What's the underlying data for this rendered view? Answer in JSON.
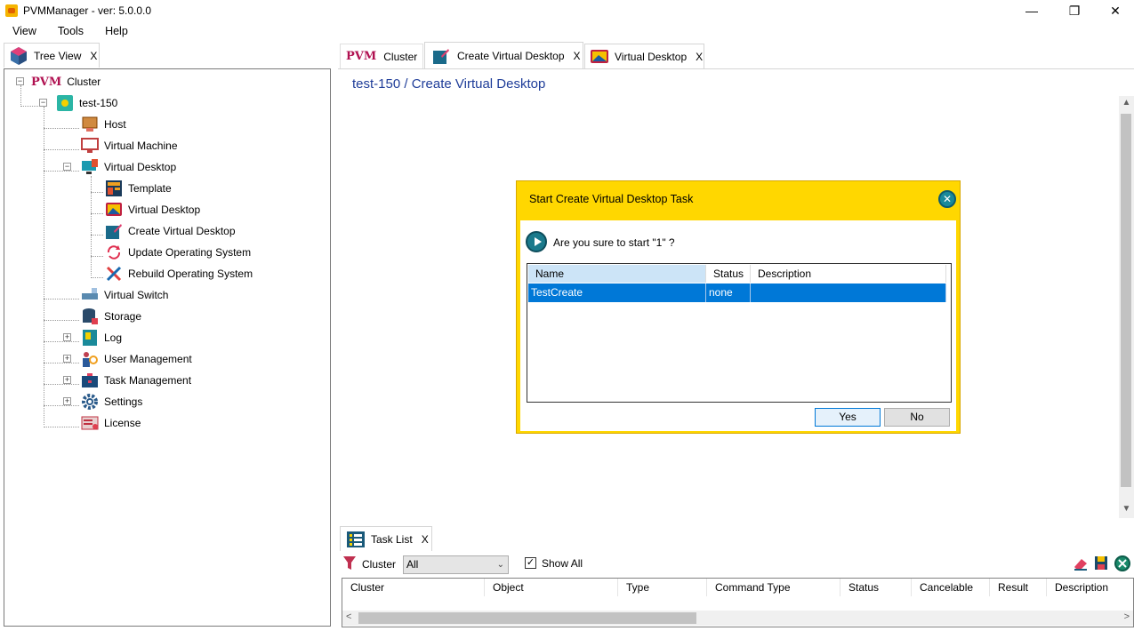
{
  "window": {
    "title": "PVMManager - ver: 5.0.0.0",
    "minimize": "—",
    "maximize": "❐",
    "close": "✕"
  },
  "menu": [
    "View",
    "Tools",
    "Help"
  ],
  "left_tab": {
    "label": "Tree View",
    "close": "X"
  },
  "tree": {
    "root": "Cluster",
    "root_logo": "PVM",
    "host_node": "test-150",
    "items": {
      "host": "Host",
      "virtual_machine": "Virtual Machine",
      "virtual_desktop": "Virtual Desktop",
      "template": "Template",
      "virtual_desktop_child": "Virtual Desktop",
      "create_virtual_desktop": "Create Virtual Desktop",
      "update_os": "Update Operating System",
      "rebuild_os": "Rebuild Operating System",
      "virtual_switch": "Virtual Switch",
      "storage": "Storage",
      "log": "Log",
      "user_management": "User Management",
      "task_management": "Task Management",
      "settings": "Settings",
      "license": "License"
    }
  },
  "doc_tabs": [
    {
      "logo": "PVM",
      "label": "Cluster",
      "close": "X"
    },
    {
      "label": "Create Virtual Desktop",
      "close": "X"
    },
    {
      "label": "Virtual Desktop",
      "close": "X"
    }
  ],
  "page": {
    "breadcrumb": "test-150 / Create Virtual Desktop"
  },
  "dialog": {
    "title": "Start Create Virtual Desktop Task",
    "close": "✕",
    "question": "Are you sure to start \"1\" ?",
    "columns": [
      "Name",
      "Status",
      "Description"
    ],
    "rows": [
      {
        "name": "TestCreate",
        "status": "none",
        "description": ""
      }
    ],
    "yes": "Yes",
    "no": "No"
  },
  "task_list": {
    "tab_label": "Task List",
    "close": "X",
    "filter_label": "Cluster",
    "filter_value": "All",
    "show_all_label": "Show All",
    "show_all_checked": "✓",
    "columns": [
      "Cluster",
      "Object",
      "Type",
      "Command Type",
      "Status",
      "Cancelable",
      "Result",
      "Description"
    ]
  },
  "colors": {
    "dialog_bg": "#ffd700",
    "selection": "#0078d7",
    "breadcrumb": "#1f3d99"
  }
}
